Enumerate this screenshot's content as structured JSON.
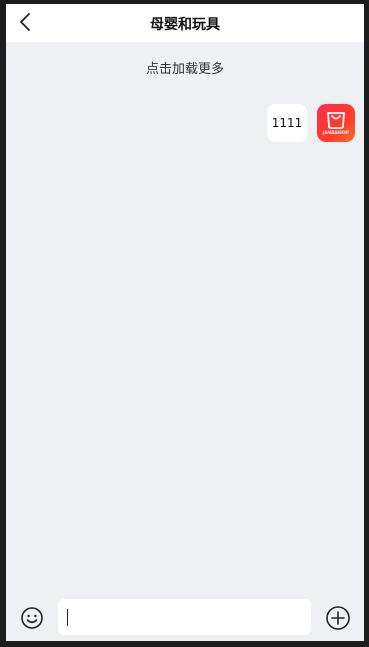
{
  "header": {
    "title": "母婴和玩具",
    "back_icon": "chevron-left-icon"
  },
  "chat": {
    "load_more": "点击加载更多",
    "messages": [
      {
        "text": "1111",
        "avatar_label": "JAVASHOP",
        "avatar_icon": "shopping-bag-icon"
      }
    ]
  },
  "input_bar": {
    "emoji_icon": "smiley-icon",
    "input_value": "",
    "plus_icon": "plus-circle-icon"
  },
  "colors": {
    "background": "#eef0f4",
    "header_bg": "#ffffff",
    "avatar_red": "#ff2f4d"
  }
}
